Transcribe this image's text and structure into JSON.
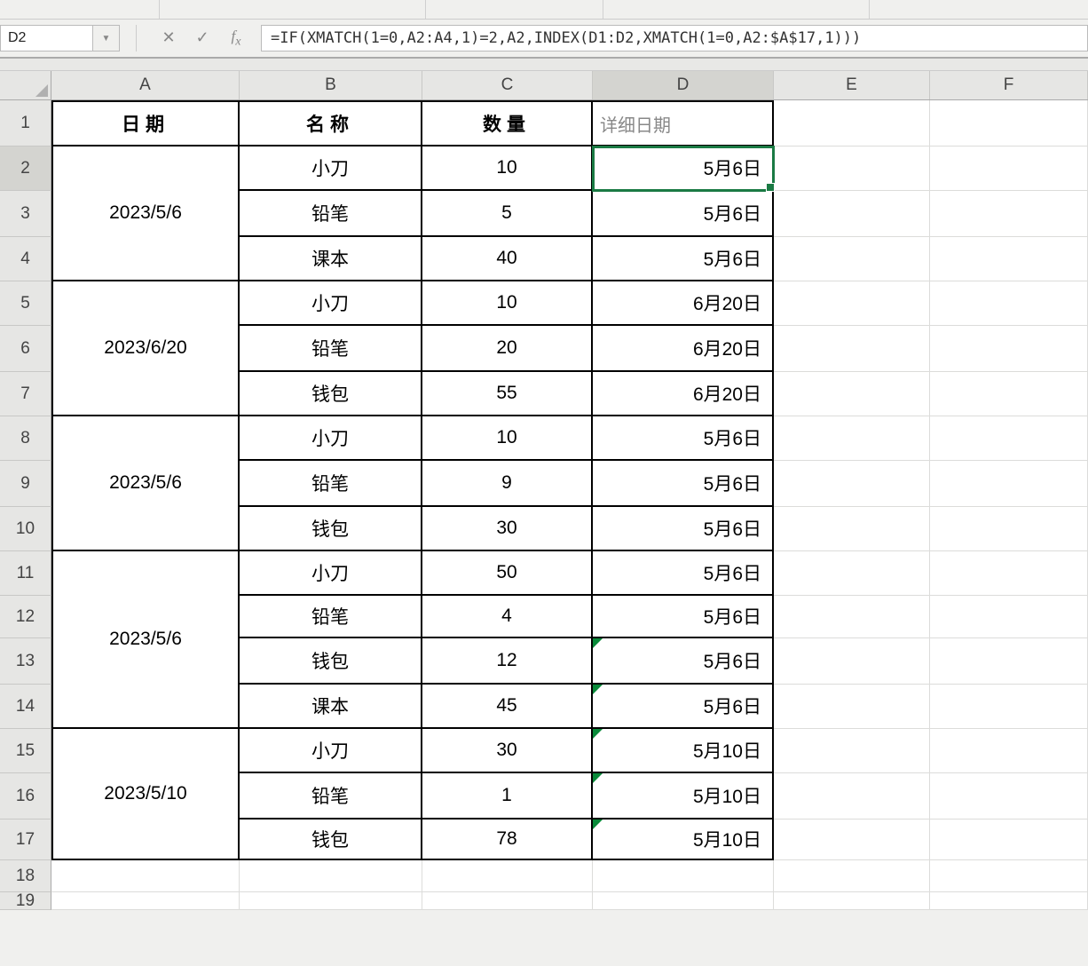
{
  "ribbon": {
    "item1": "",
    "item2": "",
    "item3": "",
    "item4": ""
  },
  "nameBox": "D2",
  "formulaBar": "=IF(XMATCH(1=0,A2:A4,1)=2,A2,INDEX(D1:D2,XMATCH(1=0,A2:$A$17,1)))",
  "columns": [
    "A",
    "B",
    "C",
    "D",
    "E",
    "F"
  ],
  "rowNums": [
    "1",
    "2",
    "3",
    "4",
    "5",
    "6",
    "7",
    "8",
    "9",
    "10",
    "11",
    "12",
    "13",
    "14",
    "15",
    "16",
    "17",
    "18",
    "19"
  ],
  "headers": {
    "A": "日期",
    "B": "名称",
    "C": "数量",
    "D": "详细日期"
  },
  "groups": [
    {
      "date": "2023/5/6",
      "rows": [
        {
          "name": "小刀",
          "qty": "10",
          "dd": "5月6日"
        },
        {
          "name": "铅笔",
          "qty": "5",
          "dd": "5月6日"
        },
        {
          "name": "课本",
          "qty": "40",
          "dd": "5月6日"
        }
      ]
    },
    {
      "date": "2023/6/20",
      "rows": [
        {
          "name": "小刀",
          "qty": "10",
          "dd": "6月20日"
        },
        {
          "name": "铅笔",
          "qty": "20",
          "dd": "6月20日"
        },
        {
          "name": "钱包",
          "qty": "55",
          "dd": "6月20日"
        }
      ]
    },
    {
      "date": "2023/5/6",
      "rows": [
        {
          "name": "小刀",
          "qty": "10",
          "dd": "5月6日"
        },
        {
          "name": "铅笔",
          "qty": "9",
          "dd": "5月6日"
        },
        {
          "name": "钱包",
          "qty": "30",
          "dd": "5月6日"
        }
      ]
    },
    {
      "date": "2023/5/6",
      "rows": [
        {
          "name": "小刀",
          "qty": "50",
          "dd": "5月6日"
        },
        {
          "name": "铅笔",
          "qty": "4",
          "dd": "5月6日"
        },
        {
          "name": "钱包",
          "qty": "12",
          "dd": "5月6日"
        },
        {
          "name": "课本",
          "qty": "45",
          "dd": "5月6日"
        }
      ]
    },
    {
      "date": "2023/5/10",
      "rows": [
        {
          "name": "小刀",
          "qty": "30",
          "dd": "5月10日"
        },
        {
          "name": "铅笔",
          "qty": "1",
          "dd": "5月10日"
        },
        {
          "name": "钱包",
          "qty": "78",
          "dd": "5月10日"
        }
      ]
    }
  ]
}
